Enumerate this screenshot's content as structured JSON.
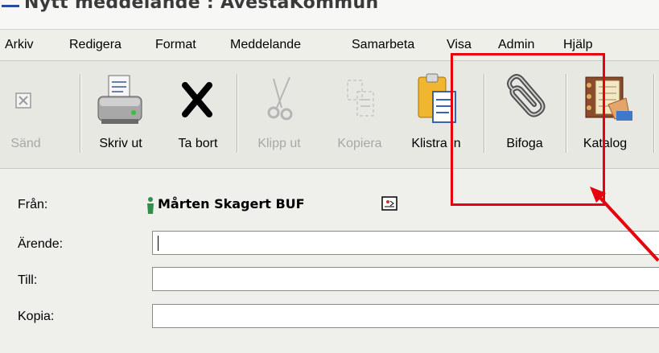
{
  "window": {
    "title": "Nytt meddelande : AvestaKommun"
  },
  "menu": [
    {
      "label": "Arkiv"
    },
    {
      "label": "Redigera"
    },
    {
      "label": "Format"
    },
    {
      "label": "Meddelande"
    },
    {
      "label": "Samarbeta"
    },
    {
      "label": "Visa"
    },
    {
      "label": "Admin"
    },
    {
      "label": "Hjälp"
    }
  ],
  "toolbar": {
    "send": "Sänd",
    "print": "Skriv ut",
    "delete": "Ta bort",
    "cut": "Klipp ut",
    "copy": "Kopiera",
    "paste": "Klistra in",
    "attach": "Bifoga",
    "catalog": "Katalog"
  },
  "form": {
    "from_label": "Från:",
    "from_value": "Mårten Skagert BUF",
    "subject_label": "Ärende:",
    "subject_value": "",
    "to_label": "Till:",
    "to_value": "",
    "cc_label": "Kopia:",
    "cc_value": ""
  },
  "icons": {
    "send": "send-icon",
    "print": "printer-icon",
    "delete": "delete-x-icon",
    "cut": "scissors-icon",
    "copy": "copy-icon",
    "paste": "paste-icon",
    "attach": "paperclip-icon",
    "catalog": "address-book-icon",
    "person": "person-icon",
    "card": "contact-card-icon"
  },
  "colors": {
    "annotation": "#e8000c",
    "disabled_text": "#a7a7a7"
  }
}
